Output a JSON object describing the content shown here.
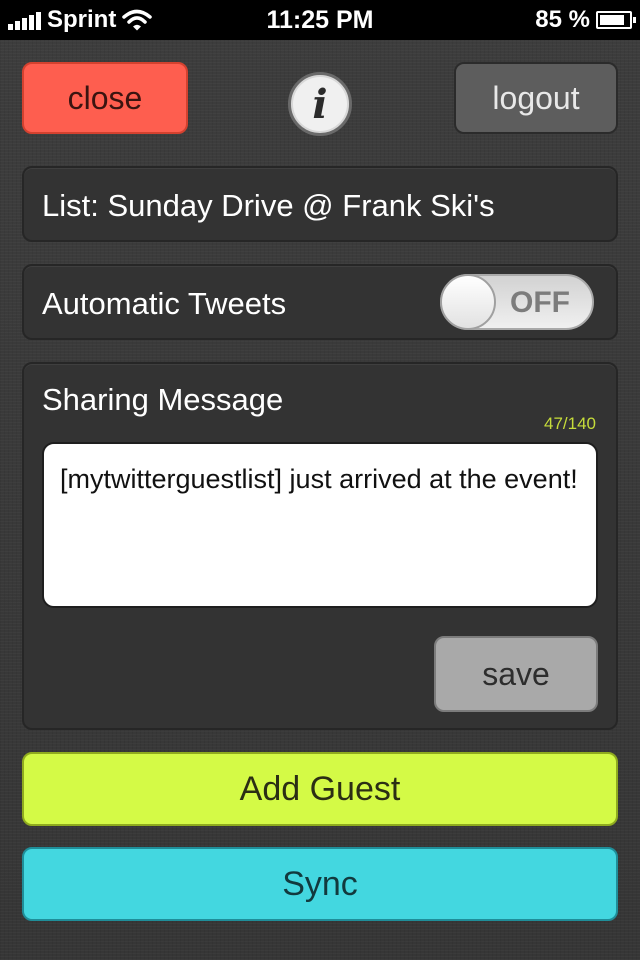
{
  "status_bar": {
    "carrier": "Sprint",
    "time": "11:25 PM",
    "battery_percent": "85 %",
    "battery_level": 0.85
  },
  "header": {
    "close_label": "close",
    "info_label": "i",
    "logout_label": "logout"
  },
  "list": {
    "label": "List: Sunday Drive @ Frank Ski's"
  },
  "tweets": {
    "label": "Automatic Tweets",
    "toggle_state": "OFF"
  },
  "sharing": {
    "label": "Sharing Message",
    "char_count": "47/140",
    "message": "[mytwitterguestlist] just arrived at the event!",
    "save_label": "save"
  },
  "actions": {
    "add_guest_label": "Add Guest",
    "sync_label": "Sync"
  },
  "colors": {
    "close": "#fe5e4f",
    "add_guest": "#d4fa46",
    "sync": "#43d7e0",
    "counter": "#c6dc3a"
  },
  "icons": [
    "signal-icon",
    "wifi-icon",
    "battery-icon",
    "info-icon"
  ]
}
